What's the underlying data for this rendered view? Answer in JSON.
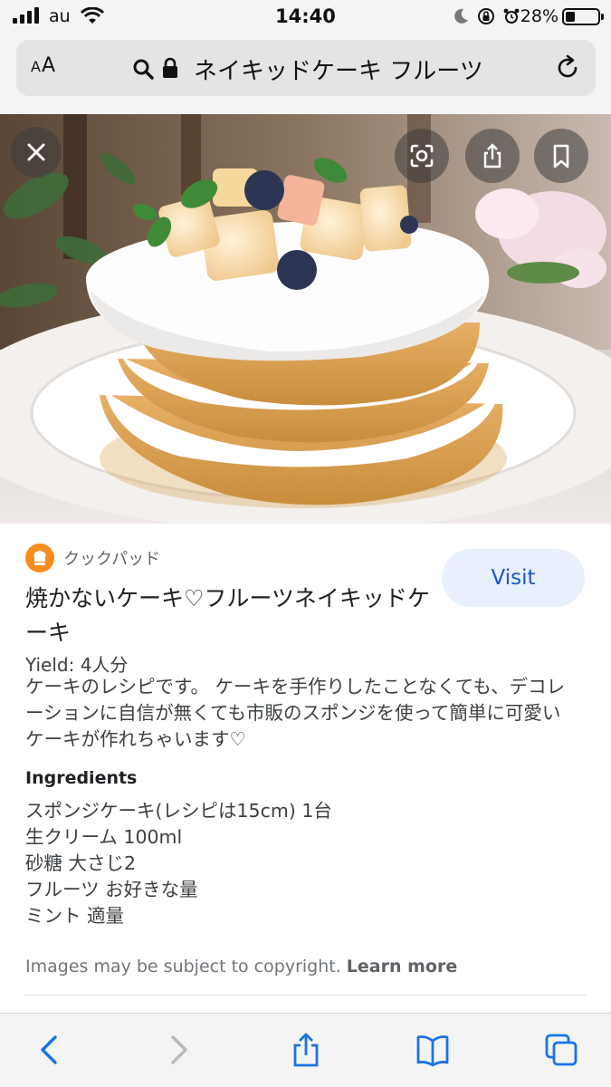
{
  "status_bar": {
    "carrier": "au",
    "time": "14:40",
    "battery_percent": "28%",
    "battery_level": 0.28,
    "icons": [
      "signal-icon",
      "wifi-icon",
      "moon-icon",
      "orientation-lock-icon",
      "alarm-icon",
      "battery-icon"
    ]
  },
  "browser": {
    "text_size_label": "AA",
    "url_text": "ネイキッドケーキ フルーツ",
    "icons": [
      "search-icon",
      "lock-icon",
      "reload-icon"
    ]
  },
  "image_viewer": {
    "icons": [
      "close-icon",
      "lens-icon",
      "share-icon",
      "bookmark-icon"
    ]
  },
  "result": {
    "source_name": "クックパッド",
    "title": "焼かないケーキ♡フルーツネイキッドケーキ",
    "visit_label": "Visit",
    "yield": "Yield: 4人分",
    "description": "ケーキのレシピです。 ケーキを手作りしたことなくても、デコレーションに自信が無くても市販のスポンジを使って簡単に可愛いケーキが作れちゃいます♡",
    "ingredients_heading": "Ingredients",
    "ingredients": [
      "スポンジケーキ(レシピは15cm) 1台",
      "生クリーム 100ml",
      "砂糖 大さじ2",
      "フルーツ お好きな量",
      "ミント 適量"
    ],
    "copyright_text": "Images may be subject to copyright.",
    "learn_more_label": "Learn more"
  },
  "toolbar": {
    "icons": [
      "back-icon",
      "forward-icon",
      "share-icon",
      "bookmarks-icon",
      "tabs-icon"
    ]
  },
  "colors": {
    "accent": "#1a57c8",
    "visit_bg": "#e8f0fe",
    "toolbar_blue": "#1a73e8",
    "source_logo": "#f58c1e"
  }
}
